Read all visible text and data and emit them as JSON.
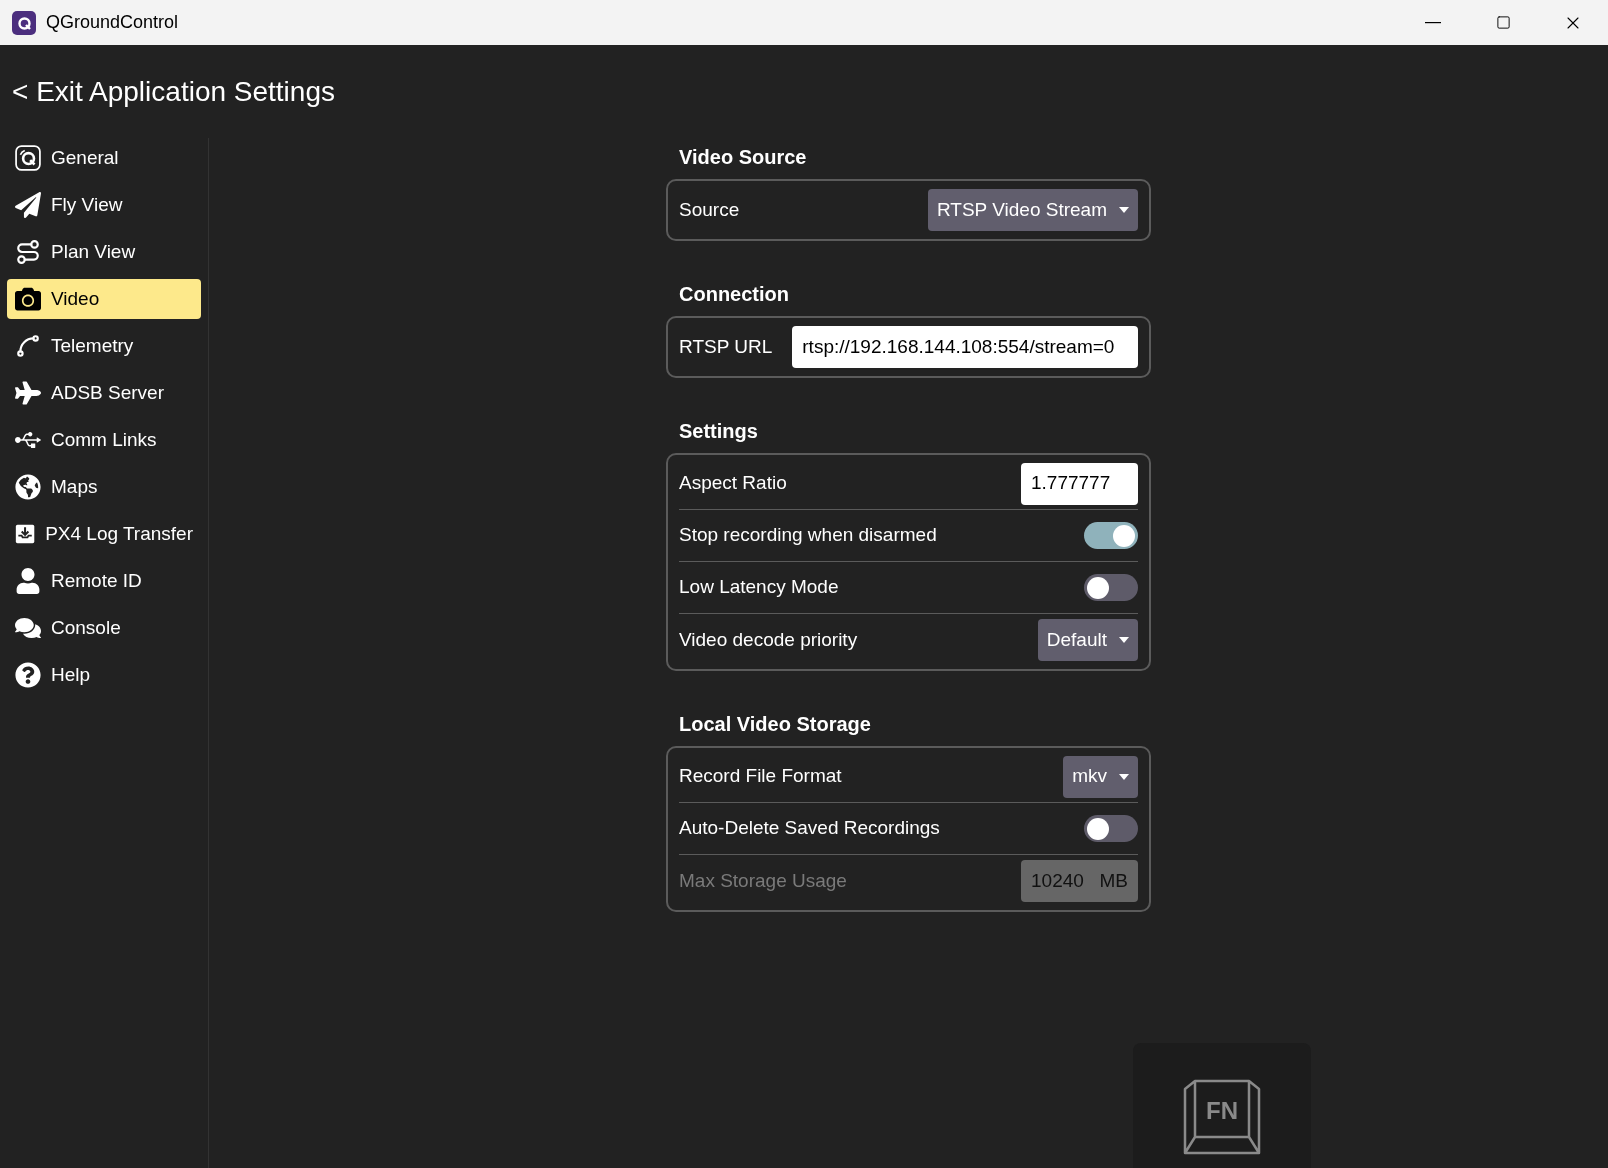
{
  "window": {
    "title": "QGroundControl"
  },
  "header": {
    "back_glyph": "<",
    "title": "Exit Application Settings"
  },
  "sidebar": {
    "items": [
      {
        "label": "General",
        "selected": false
      },
      {
        "label": "Fly View",
        "selected": false
      },
      {
        "label": "Plan View",
        "selected": false
      },
      {
        "label": "Video",
        "selected": true
      },
      {
        "label": "Telemetry",
        "selected": false
      },
      {
        "label": "ADSB Server",
        "selected": false
      },
      {
        "label": "Comm Links",
        "selected": false
      },
      {
        "label": "Maps",
        "selected": false
      },
      {
        "label": "PX4 Log Transfer",
        "selected": false
      },
      {
        "label": "Remote ID",
        "selected": false
      },
      {
        "label": "Console",
        "selected": false
      },
      {
        "label": "Help",
        "selected": false
      }
    ]
  },
  "sections": [
    {
      "title": "Video Source",
      "rows": [
        {
          "kind": "combo",
          "label": "Source",
          "value": "RTSP Video Stream",
          "disabled": false
        }
      ]
    },
    {
      "title": "Connection",
      "rows": [
        {
          "kind": "wide_text",
          "label": "RTSP URL",
          "value": "rtsp://192.168.144.108:554/stream=0",
          "disabled": false
        }
      ]
    },
    {
      "title": "Settings",
      "rows": [
        {
          "kind": "text",
          "label": "Aspect Ratio",
          "value": "1.777777",
          "disabled": false
        },
        {
          "kind": "toggle",
          "label": "Stop recording when disarmed",
          "on": true,
          "disabled": false
        },
        {
          "kind": "toggle",
          "label": "Low Latency Mode",
          "on": false,
          "disabled": false
        },
        {
          "kind": "combo",
          "label": "Video decode priority",
          "value": "Default",
          "disabled": false
        }
      ]
    },
    {
      "title": "Local Video Storage",
      "rows": [
        {
          "kind": "combo",
          "label": "Record File Format",
          "value": "mkv",
          "disabled": false
        },
        {
          "kind": "toggle",
          "label": "Auto-Delete Saved Recordings",
          "on": false,
          "disabled": false
        },
        {
          "kind": "unit_field",
          "label": "Max Storage Usage",
          "value": "10240",
          "unit": "MB",
          "disabled": true
        }
      ]
    }
  ],
  "fn_overlay": {
    "key_label": "FN"
  }
}
